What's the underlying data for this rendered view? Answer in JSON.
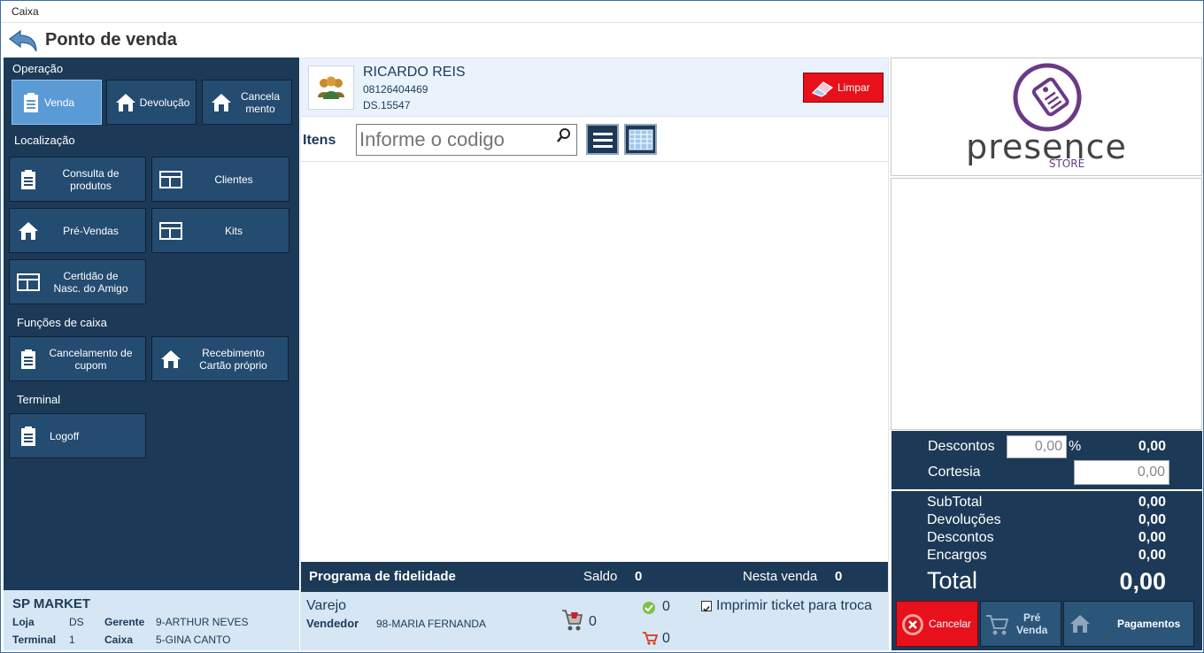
{
  "window": {
    "title": "Caixa"
  },
  "header": {
    "title": "Ponto de venda"
  },
  "left": {
    "sections": {
      "operacao": "Operação",
      "localizacao": "Localização",
      "funcoes": "Funções de caixa",
      "terminal": "Terminal"
    },
    "buttons": {
      "venda": "Venda",
      "devolucao": "Devolução",
      "cancelamento1": "Cancela",
      "cancelamento2": "mento",
      "consulta1": "Consulta de",
      "consulta2": "produtos",
      "clientes": "Clientes",
      "prevendas": "Pré-Vendas",
      "kits": "Kits",
      "certidao1": "Certidão de",
      "certidao2": "Nasc. do Amigo",
      "cancup1": "Cancelamento de",
      "cancup2": "cupom",
      "receb1": "Recebimento",
      "receb2": "Cartão próprio",
      "logoff": "Logoff"
    },
    "footer": {
      "store": "SP MARKET",
      "loja_label": "Loja",
      "loja_value": "DS",
      "gerente_label": "Gerente",
      "gerente_value": "9-ARTHUR NEVES",
      "terminal_label": "Terminal",
      "terminal_value": "1",
      "caixa_label": "Caixa",
      "caixa_value": "5-GINA CANTO"
    }
  },
  "customer": {
    "name": "RICARDO REIS",
    "phone": "08126404469",
    "code": "DS.15547",
    "clear_label": "Limpar"
  },
  "items": {
    "label": "Itens",
    "placeholder": "Informe o codigo"
  },
  "fidelidade": {
    "title": "Programa de fidelidade",
    "saldo_label": "Saldo",
    "saldo_value": "0",
    "nesta_label": "Nesta venda",
    "nesta_value": "0"
  },
  "sale_info": {
    "type": "Varejo",
    "vendedor_label": "Vendedor",
    "vendedor_value": "98-MARIA FERNANDA",
    "cart_count": "0",
    "ok_count": "0",
    "cart2_count": "0",
    "print_label": "Imprimir ticket para troca"
  },
  "brand": {
    "name": "presence",
    "sub": "STORE",
    "color": "#6b3a86"
  },
  "discounts": {
    "descontos_label": "Descontos",
    "descontos_input": "0,00",
    "percent": "%",
    "descontos_value": "0,00",
    "cortesia_label": "Cortesia",
    "cortesia_input": "0,00"
  },
  "totals": {
    "subtotal_label": "SubTotal",
    "subtotal_value": "0,00",
    "devolucoes_label": "Devoluções",
    "devolucoes_value": "0,00",
    "descontos_label": "Descontos",
    "descontos_value": "0,00",
    "encargos_label": "Encargos",
    "encargos_value": "0,00",
    "total_label": "Total",
    "total_value": "0,00"
  },
  "actions": {
    "cancelar": "Cancelar",
    "prevenda1": "Pré",
    "prevenda2": "Venda",
    "pagamentos": "Pagamentos"
  }
}
